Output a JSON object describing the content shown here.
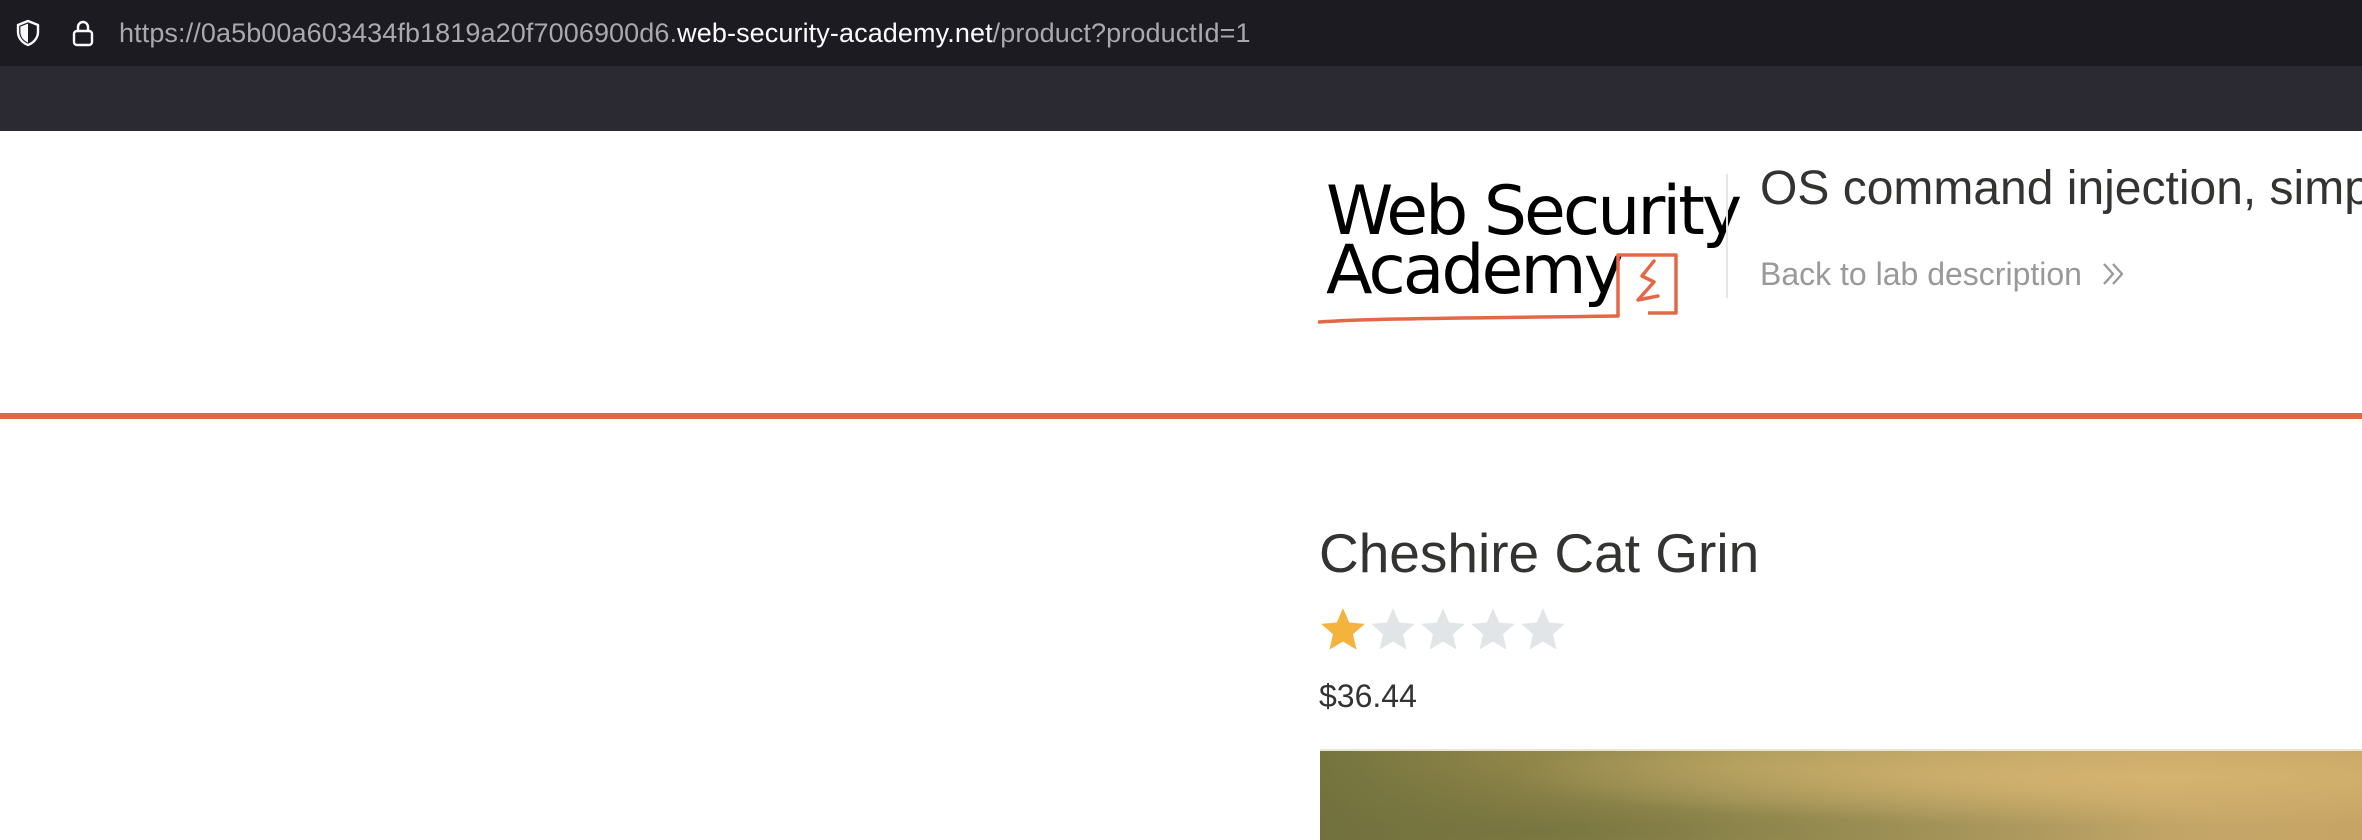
{
  "browser": {
    "url_prefix": "https://0a5b00a603434fb1819a20f7006900d6.",
    "url_host": "web-security-academy.net",
    "url_path": "/product?productId=1",
    "icons": [
      "shield-icon",
      "lock-icon"
    ]
  },
  "lab_header": {
    "logo": {
      "line1": "Web Security",
      "line2": "Academy",
      "accent_color": "#e36847"
    },
    "title": "OS command injection, simp",
    "back_link_label": "Back to lab description",
    "back_link_icon": "double-chevron-right-icon",
    "rule_color": "#e36847"
  },
  "product": {
    "name": "Cheshire Cat Grin",
    "rating": 1,
    "rating_max": 5,
    "star_filled_color": "#f3b33d",
    "star_empty_color": "#e1e5e8",
    "price": "$36.44"
  }
}
